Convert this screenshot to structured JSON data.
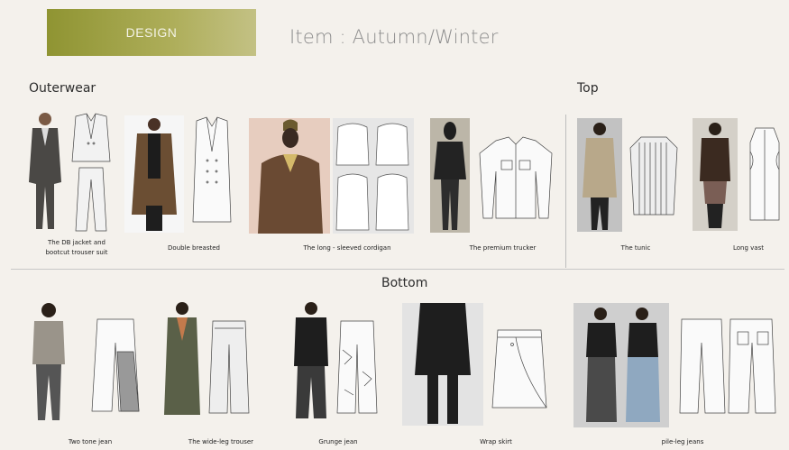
{
  "header": {
    "design_tab": "DESIGN",
    "title": "Item : Autumn/Winter"
  },
  "sections": {
    "outerwear": "Outerwear",
    "top": "Top",
    "bottom": "Bottom"
  },
  "items": {
    "db_jacket": "The DB jacket and\nbootcut trouser suit",
    "double_breasted": "Double breasted",
    "cardigan": "The long - sleeved cordigan",
    "trucker": "The premium trucker",
    "tunic": "The tunic",
    "long_vest": "Long vast",
    "two_tone": "Two tone jean",
    "wide_leg": "The wide-leg trouser",
    "grunge": "Grunge jean",
    "wrap_skirt": "Wrap skirt",
    "pile_leg": "pile-leg jeans"
  },
  "colors": {
    "accent": "#9a9c45",
    "background": "#f4f1ec",
    "divider": "#bdbdbd"
  }
}
